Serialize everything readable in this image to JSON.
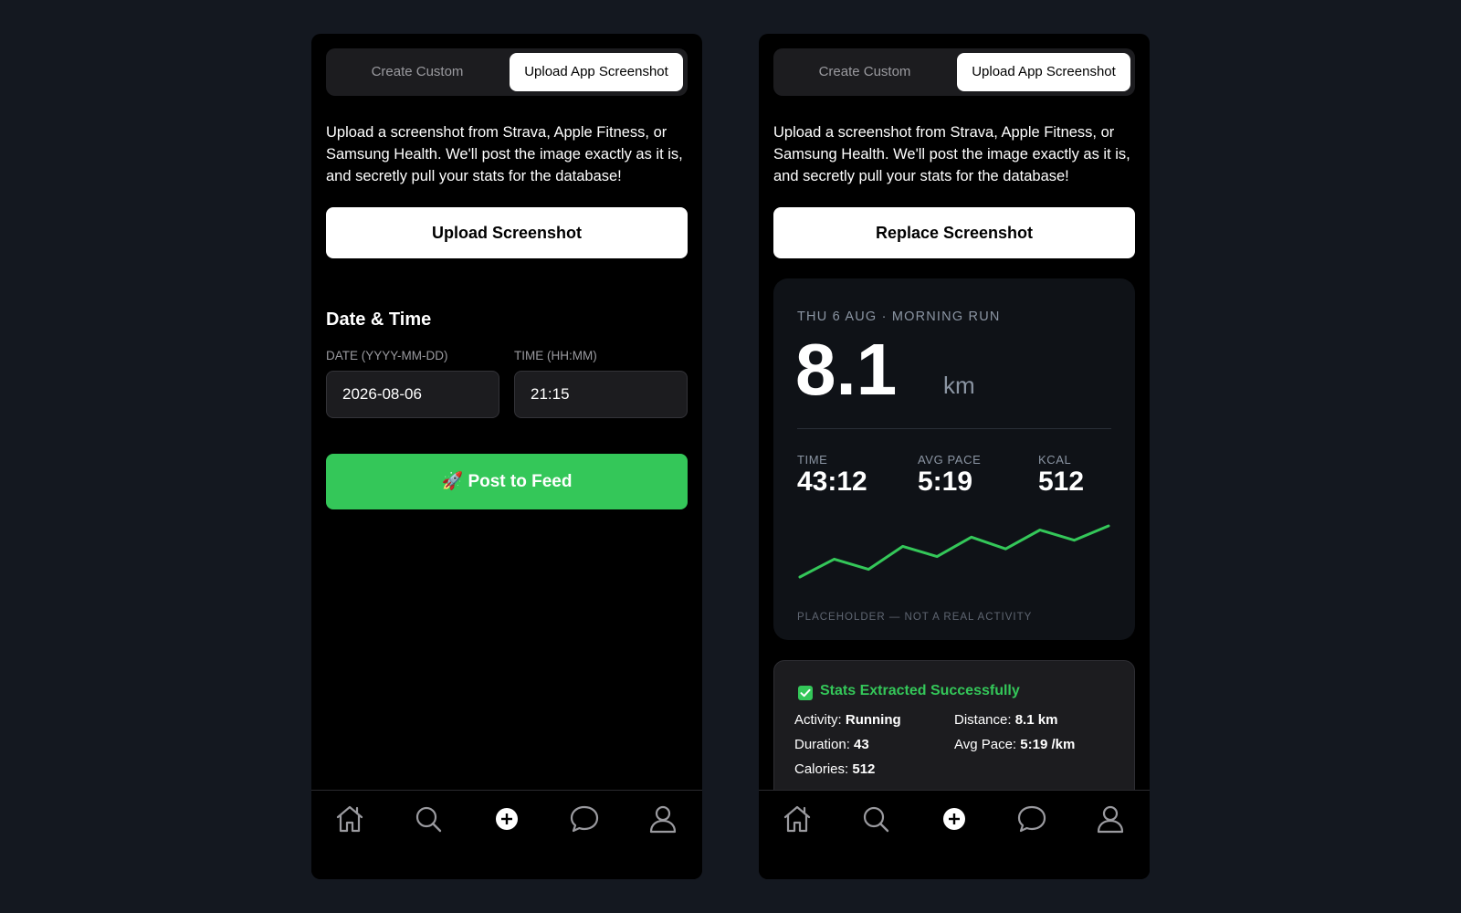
{
  "tabs": {
    "create_custom": "Create Custom",
    "upload_app_screenshot": "Upload App Screenshot"
  },
  "description": "Upload a screenshot from Strava, Apple Fitness, or Samsung Health. We'll post the image exactly as it is, and secretly pull your stats for the database!",
  "left": {
    "upload_button": "Upload Screenshot",
    "section_title": "Date & Time",
    "date_label": "DATE (YYYY-MM-DD)",
    "date_value": "2026-08-06",
    "time_label": "TIME (HH:MM)",
    "time_value": "21:15",
    "post_button": "🚀 Post to Feed"
  },
  "right": {
    "replace_button": "Replace Screenshot",
    "card": {
      "header": "THU 6 AUG · MORNING RUN",
      "distance": "8.1",
      "unit": "km",
      "stats": [
        {
          "label": "TIME",
          "value": "43:12"
        },
        {
          "label": "AVG PACE",
          "value": "5:19"
        },
        {
          "label": "KCAL",
          "value": "512"
        }
      ],
      "sparkline": [
        0.0,
        0.35,
        0.15,
        0.6,
        0.4,
        0.78,
        0.55,
        0.92,
        0.72,
        1.0
      ],
      "note": "PLACEHOLDER — NOT A REAL ACTIVITY"
    },
    "extract": {
      "title": "Stats Extracted Successfully",
      "activity_label": "Activity:",
      "activity_value": "Running",
      "distance_label": "Distance:",
      "distance_value": "8.1 km",
      "duration_label": "Duration:",
      "duration_value": "43",
      "pace_label": "Avg Pace:",
      "pace_value": "5:19 /km",
      "calories_label": "Calories:",
      "calories_value": "512"
    }
  },
  "nav": {
    "items": [
      "home-icon",
      "search-icon",
      "add-icon",
      "chat-icon",
      "profile-icon"
    ]
  },
  "colors": {
    "accent_green": "#34c759",
    "background": "#141820",
    "card_bg": "#0f1217"
  }
}
